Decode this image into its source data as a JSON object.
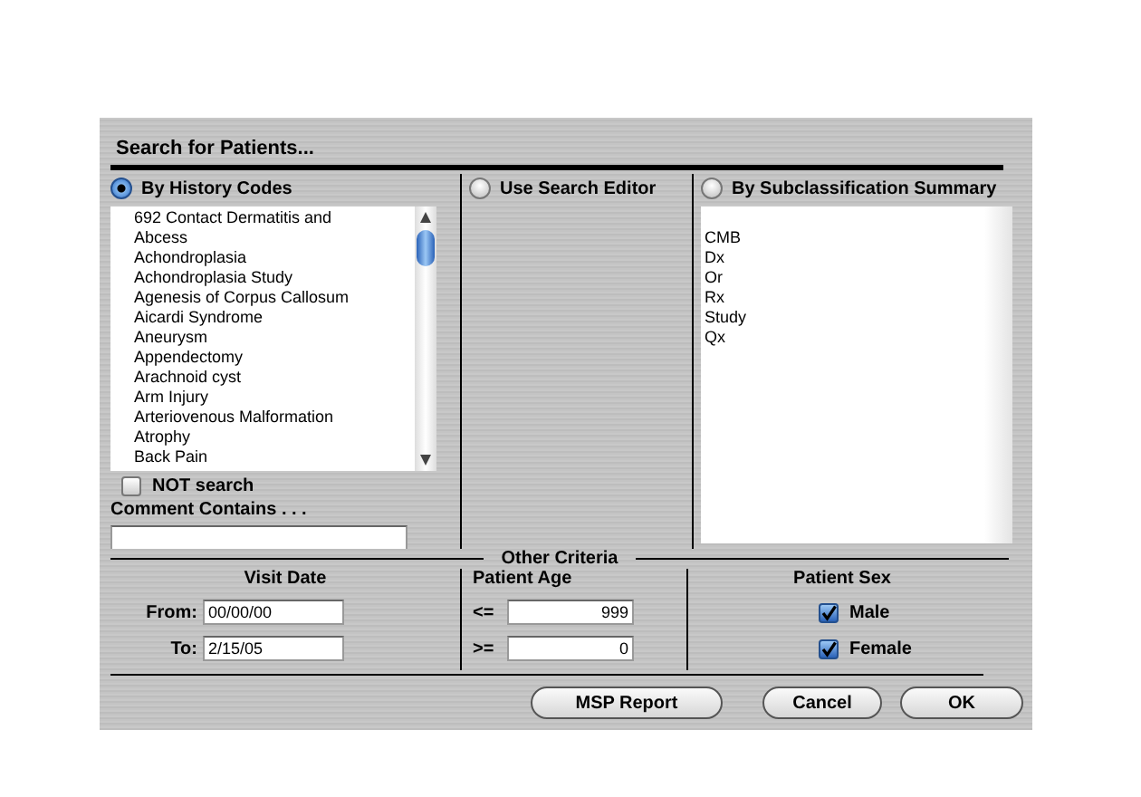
{
  "window": {
    "title": "Search for Patients..."
  },
  "search_modes": [
    {
      "label": "By History Codes",
      "selected": true
    },
    {
      "label": "Use Search Editor",
      "selected": false
    },
    {
      "label": "By Subclassification Summary",
      "selected": false
    }
  ],
  "history_codes": [
    "692    Contact Dermatitis and Abcess",
    "Achondroplasia",
    "Achondroplasia Study",
    "Agenesis of Corpus Callosum",
    "Aicardi Syndrome",
    "Aneurysm",
    "Appendectomy",
    "Arachnoid cyst",
    "Arm Injury",
    "Arteriovenous Malformation",
    "Atrophy",
    "Back Pain"
  ],
  "not_search": {
    "label": "NOT search",
    "checked": false
  },
  "comment": {
    "label": "Comment Contains . . ."
  },
  "subclassifications": [
    "CMB",
    "Dx",
    "Or",
    "Rx",
    "Study",
    "Qx"
  ],
  "other_criteria": {
    "title": "Other Criteria",
    "visit_date": {
      "title": "Visit Date",
      "from_label": "From:",
      "from": "00/00/00",
      "to_label": "To:",
      "to": "2/15/05"
    },
    "patient_age": {
      "title": "Patient Age",
      "max_label": "<=",
      "max": "999",
      "min_label": ">=",
      "min": "0"
    },
    "patient_sex": {
      "title": "Patient Sex",
      "options": [
        {
          "label": "Male",
          "checked": true
        },
        {
          "label": "Female",
          "checked": true
        }
      ]
    }
  },
  "buttons": [
    "MSP Report",
    "Cancel",
    "OK"
  ]
}
